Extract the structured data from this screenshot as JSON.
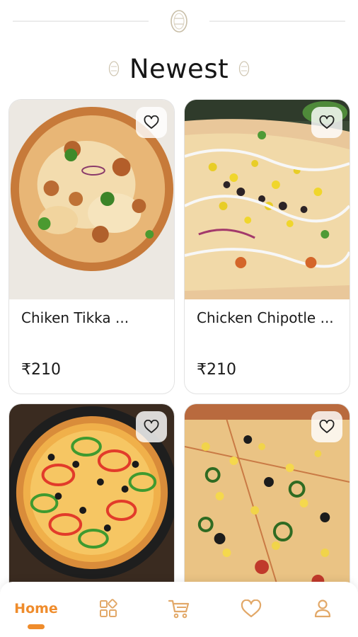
{
  "header": {
    "title": "Newest"
  },
  "products": [
    {
      "name": "Chiken Tikka ...",
      "price": "₹210",
      "favorite": false
    },
    {
      "name": "Chicken Chipotle ...",
      "price": "₹210",
      "favorite": false
    },
    {
      "name": "",
      "price": "",
      "favorite": false
    },
    {
      "name": "",
      "price": "",
      "favorite": false
    }
  ],
  "bottom_nav": {
    "items": [
      {
        "label": "Home",
        "icon": "home",
        "active": true
      },
      {
        "label": "",
        "icon": "categories-icon",
        "active": false
      },
      {
        "label": "",
        "icon": "cart-icon",
        "active": false
      },
      {
        "label": "",
        "icon": "heart-icon",
        "active": false
      },
      {
        "label": "",
        "icon": "profile-icon",
        "active": false
      }
    ]
  },
  "colors": {
    "accent": "#ef8c2c",
    "icon_muted": "#e2a868",
    "text": "#1a1a1a"
  }
}
